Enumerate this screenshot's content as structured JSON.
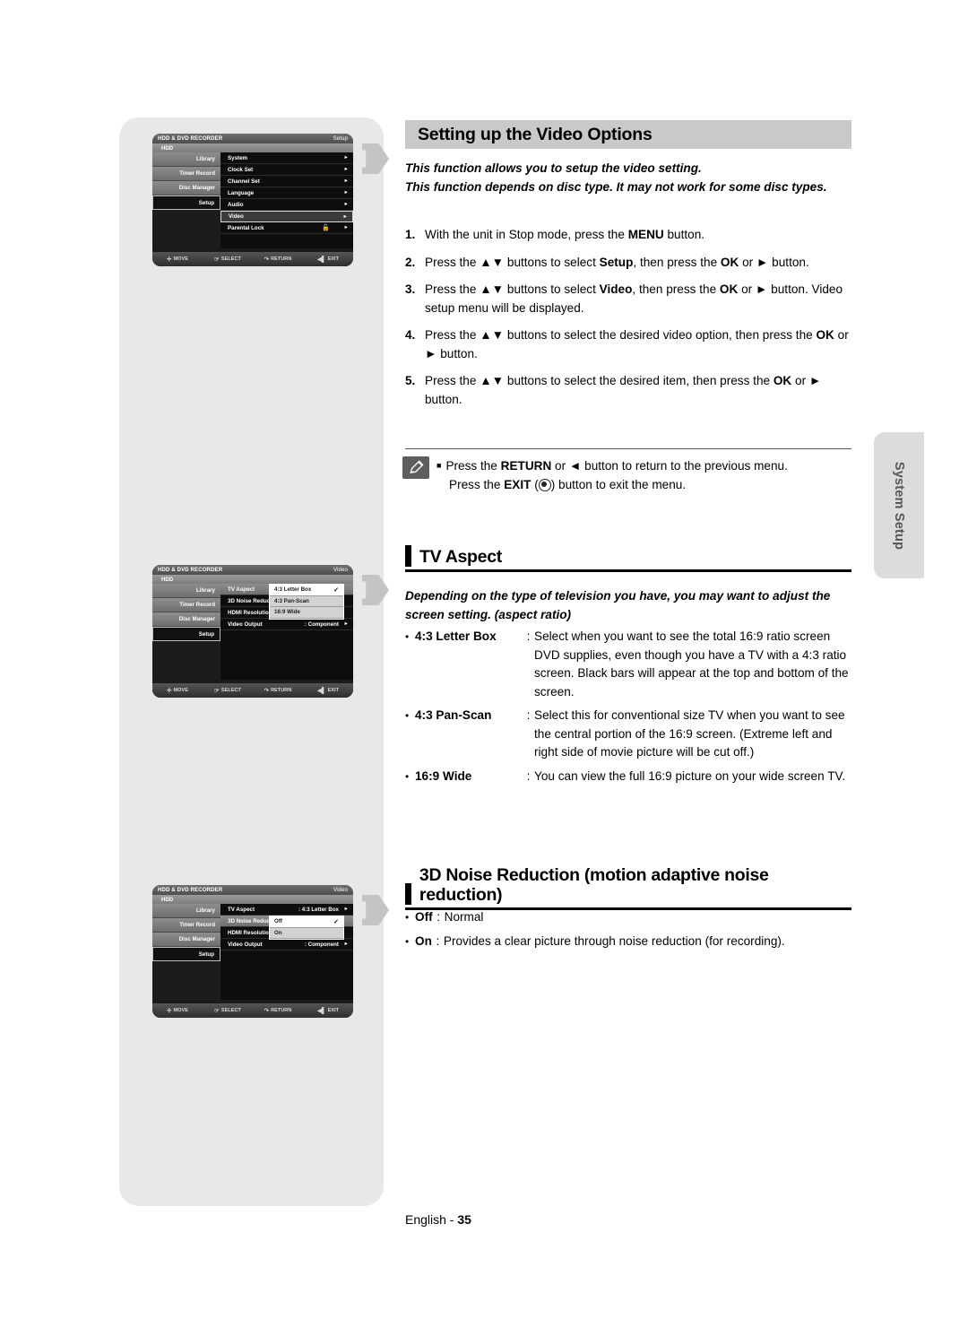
{
  "page": {
    "footer_lang": "English",
    "footer_sep": " - ",
    "footer_page": "35"
  },
  "side_tab": {
    "label": "System Setup"
  },
  "heading_main": {
    "title": "Setting up the Video Options"
  },
  "intro": {
    "line1": "This function allows you to setup the video setting.",
    "line2": "This function depends on disc type. It may not work for some disc types."
  },
  "steps": [
    {
      "num": "1.",
      "text_pre": "With the unit in Stop mode, press the ",
      "bold1": "MENU",
      "text_post": " button."
    },
    {
      "num": "2.",
      "text_pre": "Press the ▲▼ buttons to select ",
      "bold1": "Setup",
      "mid": ", then press the ",
      "bold2": "OK",
      "text_post": " or ► button."
    },
    {
      "num": "3.",
      "text_pre": "Press the ▲▼ buttons to select ",
      "bold1": "Video",
      "mid": ", then press the ",
      "bold2": "OK",
      "text_post": " or ► button. Video setup menu will be displayed."
    },
    {
      "num": "4.",
      "text_pre": "Press the ▲▼ buttons to select the desired video option, then press the ",
      "bold1": "OK",
      "text_post": " or ► button."
    },
    {
      "num": "5.",
      "text_pre": "Press the ▲▼ buttons to select the desired item, then press the ",
      "bold1": "OK",
      "text_post": " or ► button."
    }
  ],
  "note": {
    "icon": "pencil-icon",
    "line1_pre": "Press the ",
    "line1_bold": "RETURN",
    "line1_post": " or ◄ button to return to the previous menu.",
    "line2_pre": "Press the ",
    "line2_bold": "EXIT",
    "line2_mid": " (",
    "line2_post": ") button to exit the menu."
  },
  "section_tv_aspect": {
    "heading": "TV Aspect",
    "intro": "Depending on the type of television you have, you may want to adjust the screen setting. (aspect ratio)",
    "items": [
      {
        "term": "4:3 Letter Box",
        "desc": "Select when you want to see the total 16:9 ratio screen DVD supplies, even though you have a TV with a 4:3 ratio screen. Black bars will appear at the top and bottom of the screen."
      },
      {
        "term": "4:3 Pan-Scan",
        "desc": "Select this for conventional size TV when you want to see the central portion of the 16:9 screen. (Extreme left and right side of movie picture will be cut off.)"
      },
      {
        "term": "16:9 Wide",
        "desc": "You can view the full 16:9 picture on your wide screen TV."
      }
    ]
  },
  "section_3d_noise": {
    "heading": "3D Noise Reduction (motion adaptive noise reduction)",
    "items": [
      {
        "term": "Off",
        "desc": "Normal"
      },
      {
        "term": "On",
        "desc": "Provides a clear picture through noise reduction (for recording)."
      }
    ]
  },
  "osd_common": {
    "device_title": "HDD & DVD RECORDER",
    "hdd_label": "HDD",
    "sidebar": [
      "Library",
      "Timer Record",
      "Disc Manager",
      "Setup"
    ],
    "selected_sidebar": "Setup",
    "footer": [
      {
        "glyph": "✛",
        "label": "MOVE"
      },
      {
        "glyph": "☞",
        "label": "SELECT"
      },
      {
        "glyph": "↷",
        "label": "RETURN"
      },
      {
        "glyph": "◀▌",
        "label": "EXIT"
      }
    ]
  },
  "osd_1": {
    "mode_label": "Setup",
    "rows": [
      {
        "label": "System",
        "value": "",
        "arrow": "►",
        "state": "normal"
      },
      {
        "label": "Clock Set",
        "value": "",
        "arrow": "►",
        "state": "normal"
      },
      {
        "label": "Channel Set",
        "value": "",
        "arrow": "►",
        "state": "normal"
      },
      {
        "label": "Language",
        "value": "",
        "arrow": "►",
        "state": "normal"
      },
      {
        "label": "Audio",
        "value": "",
        "arrow": "►",
        "state": "normal"
      },
      {
        "label": "Video",
        "value": "",
        "arrow": "►",
        "state": "highlight"
      },
      {
        "label": "Parental Lock",
        "value": "",
        "arrow": "►",
        "state": "lock"
      }
    ]
  },
  "osd_2": {
    "mode_label": "Video",
    "rows": [
      {
        "label": "TV Aspect",
        "value": "",
        "arrow": "",
        "state": "rowsel"
      },
      {
        "label": "3D Noise Reduc",
        "value": "",
        "arrow": "",
        "state": "normal"
      },
      {
        "label": "HDMI Resolution",
        "value": "",
        "arrow": "",
        "state": "normal"
      },
      {
        "label": "Video Output",
        "value": ": Component",
        "arrow": "►",
        "state": "normal"
      }
    ],
    "popup": {
      "options": [
        {
          "label": "4:3 Letter Box",
          "checked": true
        },
        {
          "label": "4:3 Pan-Scan",
          "checked": false
        },
        {
          "label": "16:9 Wide",
          "checked": false
        }
      ]
    }
  },
  "osd_3": {
    "mode_label": "Video",
    "rows": [
      {
        "label": "TV Aspect",
        "value": ": 4:3 Letter Box",
        "arrow": "►",
        "state": "normal"
      },
      {
        "label": "3D Noise Reduc",
        "value": "",
        "arrow": "",
        "state": "rowsel"
      },
      {
        "label": "HDMI Resolution",
        "value": "",
        "arrow": "",
        "state": "normal"
      },
      {
        "label": "Video Output",
        "value": ": Component",
        "arrow": "►",
        "state": "normal"
      }
    ],
    "popup": {
      "options": [
        {
          "label": "Off",
          "checked": true
        },
        {
          "label": "On",
          "checked": false
        }
      ]
    }
  }
}
